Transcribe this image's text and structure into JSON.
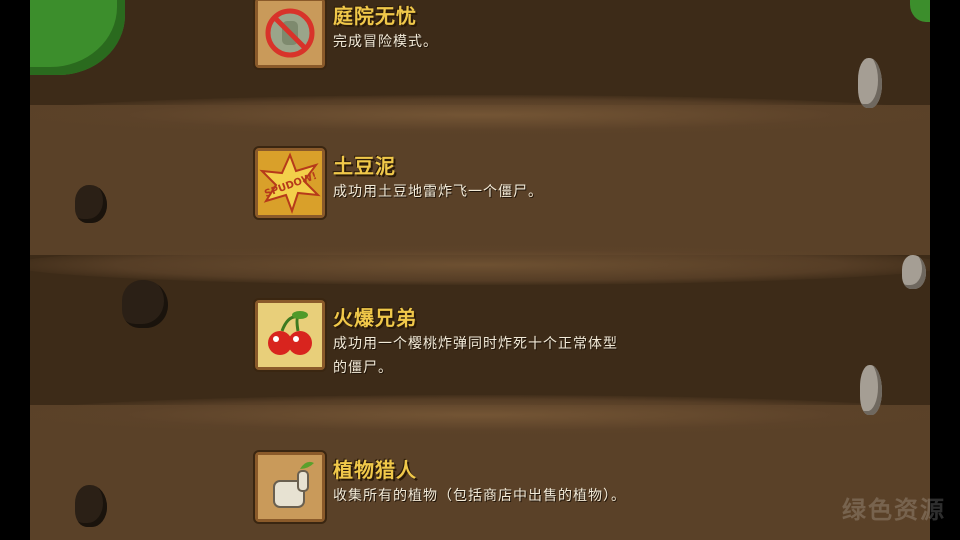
{
  "achievements": [
    {
      "title": "庭院无忧",
      "description": "完成冒险模式。",
      "icon": "no-zombie-icon"
    },
    {
      "title": "土豆泥",
      "description": "成功用土豆地雷炸飞一个僵尸。",
      "icon": "spudow-icon",
      "icon_text": "SPUDOW!"
    },
    {
      "title": "火爆兄弟",
      "description": "成功用一个樱桃炸弹同时炸死十个正常体型的僵尸。",
      "icon": "cherry-bomb-icon"
    },
    {
      "title": "植物猎人",
      "description": "收集所有的植物（包括商店中出售的植物）。",
      "icon": "green-thumb-icon"
    }
  ],
  "watermark": "绿色资源"
}
